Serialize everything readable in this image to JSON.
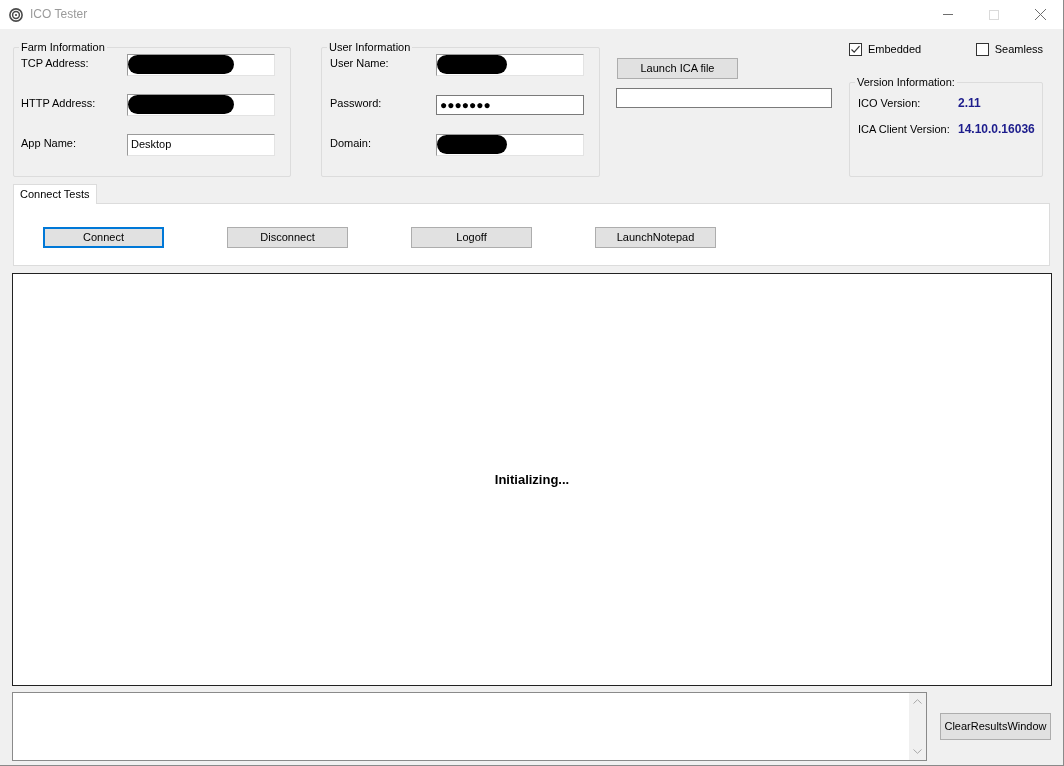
{
  "window": {
    "title": "ICO Tester",
    "controls": [
      {
        "kind": "minimize",
        "disabled": false
      },
      {
        "kind": "maximize",
        "disabled": true
      },
      {
        "kind": "close",
        "disabled": false
      }
    ]
  },
  "farm_information": {
    "title": "Farm Information",
    "fields": [
      {
        "label": "TCP Address:",
        "kind": "text",
        "redacted": true
      },
      {
        "label": "HTTP Address:",
        "kind": "text",
        "redacted": true
      },
      {
        "label": "App Name:",
        "kind": "text",
        "value": "Desktop"
      }
    ]
  },
  "user_information": {
    "title": "User Information",
    "fields": [
      {
        "label": "User Name:",
        "kind": "text",
        "redacted": true
      },
      {
        "label": "Password:",
        "kind": "password",
        "value": "●●●●●●●"
      },
      {
        "label": "Domain:",
        "kind": "text",
        "redacted": true
      }
    ]
  },
  "ica_file": {
    "button": "Launch ICA file"
  },
  "options": [
    {
      "label": "Embedded",
      "checked": true
    },
    {
      "label": "Seamless",
      "checked": false
    }
  ],
  "version_information": {
    "title": "Version Information:",
    "rows": [
      {
        "label": "ICO Version:",
        "value": "2.11"
      },
      {
        "label": "ICA Client Version:",
        "value": "14.10.0.16036"
      }
    ]
  },
  "tabs": [
    {
      "label": "Connect Tests",
      "selected": true
    }
  ],
  "connect_buttons": [
    {
      "label": "Connect",
      "focused": true
    },
    {
      "label": "Disconnect",
      "focused": false
    },
    {
      "label": "Logoff",
      "focused": false
    },
    {
      "label": "LaunchNotepad",
      "focused": false
    }
  ],
  "results": {
    "message": "Initializing..."
  },
  "log": {
    "button": "ClearResultsWindow"
  }
}
